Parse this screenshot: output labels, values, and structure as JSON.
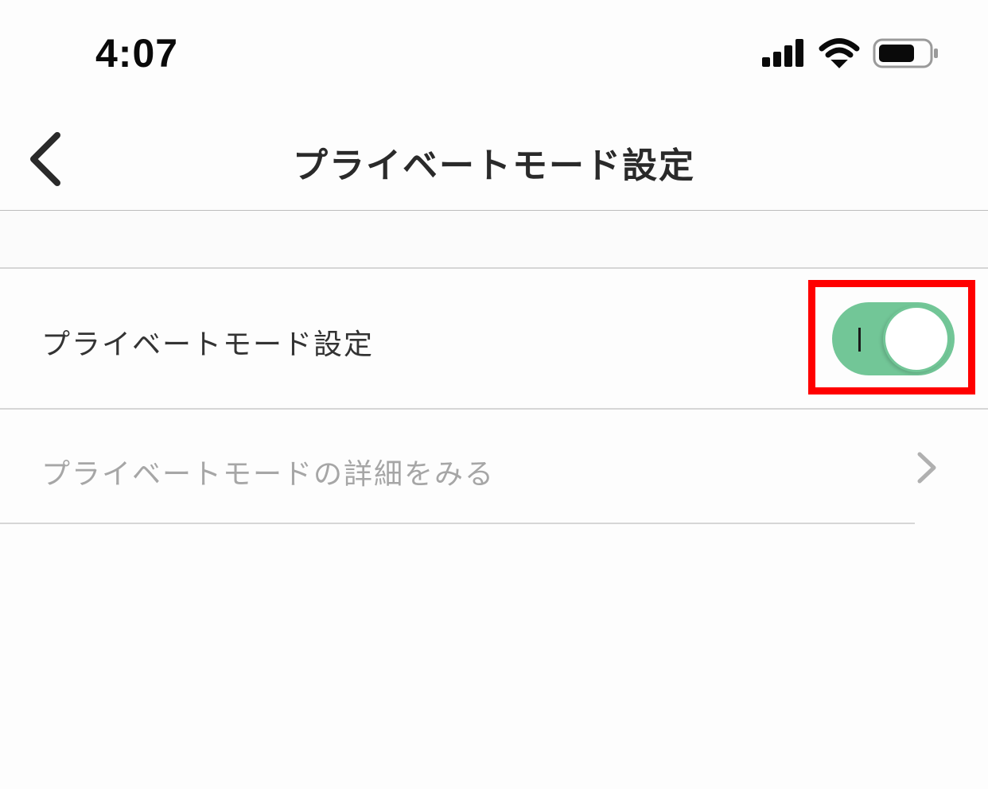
{
  "status_bar": {
    "time": "4:07",
    "icons": [
      "cellular-signal-icon",
      "wifi-icon",
      "battery-icon"
    ]
  },
  "nav": {
    "back_icon": "chevron-left-icon",
    "title": "プライベートモード設定"
  },
  "settings": {
    "private_mode": {
      "label": "プライベートモード設定",
      "enabled": true,
      "toggle_color": "#72c697",
      "highlight_color": "#ff0000"
    },
    "details": {
      "label": "プライベートモードの詳細をみる",
      "icon": "chevron-right-icon"
    }
  }
}
